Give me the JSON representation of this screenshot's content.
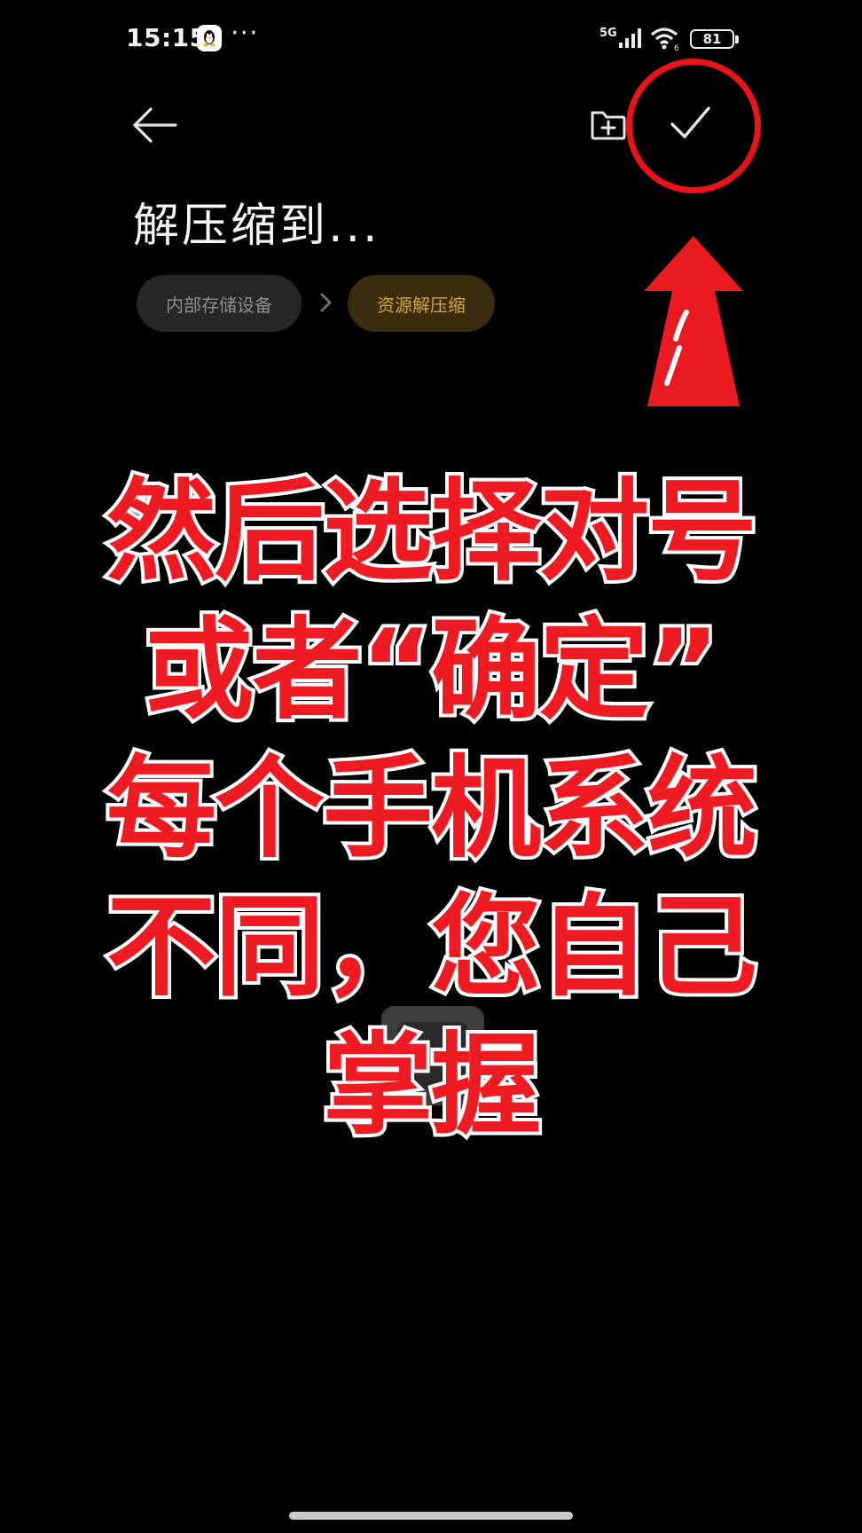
{
  "status_bar": {
    "time": "15:15",
    "more": "···",
    "network": "5G",
    "wifi_level": "6",
    "battery": "81",
    "qq_icon": "qq-penguin-icon"
  },
  "top_bar": {
    "back_icon": "arrow-left-icon",
    "new_folder_icon": "folder-plus-icon",
    "confirm_icon": "checkmark-icon"
  },
  "page": {
    "title": "解压缩到..."
  },
  "breadcrumb": {
    "items": [
      {
        "label": "内部存储设备"
      },
      {
        "label": "资源解压缩"
      }
    ],
    "separator_icon": "chevron-right-icon",
    "active_color": "#d9a43a"
  },
  "annotation": {
    "caption_lines": [
      "然后选择对号",
      "或者“确定”",
      "每个手机系统",
      "不同，您自己",
      "掌握"
    ],
    "highlight_color": "#e8141a"
  }
}
